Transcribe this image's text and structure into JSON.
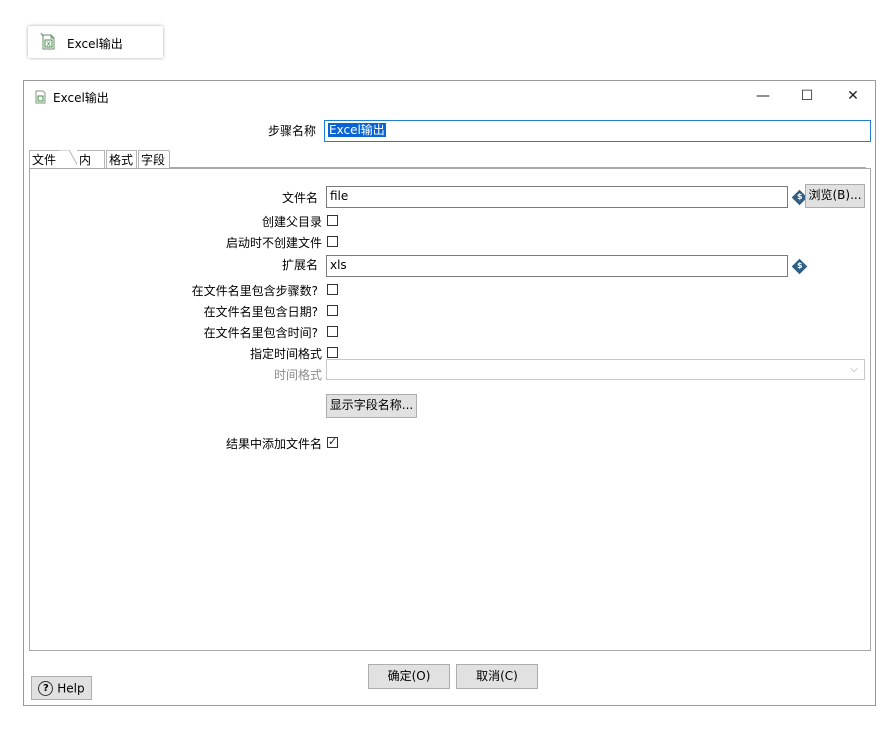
{
  "node": {
    "label": "Excel输出",
    "icon": "excel-file-icon"
  },
  "window": {
    "title": "Excel输出",
    "icon": "excel-file-icon",
    "minimize": "—",
    "maximize": "☐",
    "close": "✕"
  },
  "step": {
    "label": "步骤名称",
    "value": "Excel输出"
  },
  "tabs": [
    {
      "label": "文件",
      "active": true
    },
    {
      "label": "内容",
      "active": false
    },
    {
      "label": "格式",
      "active": false
    },
    {
      "label": "字段",
      "active": false
    }
  ],
  "file_tab": {
    "filename_label": "文件名",
    "filename_value": "file",
    "browse_button": "浏览(B)...",
    "create_parent_label": "创建父目录",
    "create_parent_checked": false,
    "no_create_on_start_label": "启动时不创建文件",
    "no_create_on_start_checked": false,
    "extension_label": "扩展名",
    "extension_value": "xls",
    "include_stepnr_label": "在文件名里包含步骤数?",
    "include_stepnr_checked": false,
    "include_date_label": "在文件名里包含日期?",
    "include_date_checked": false,
    "include_time_label": "在文件名里包含时间?",
    "include_time_checked": false,
    "specify_format_label": "指定时间格式",
    "specify_format_checked": false,
    "date_format_label": "时间格式",
    "date_format_value": "",
    "show_fields_button": "显示字段名称...",
    "add_to_result_label": "结果中添加文件名",
    "add_to_result_checked": true,
    "variable_icon": "dollar-diamond-icon"
  },
  "footer": {
    "help_button": "Help",
    "ok_button": "确定(O)",
    "cancel_button": "取消(C)"
  }
}
